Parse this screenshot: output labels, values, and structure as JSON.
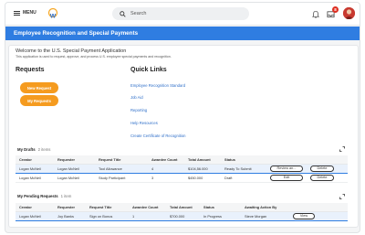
{
  "topbar": {
    "menu_label": "MENU",
    "search_placeholder": "Search",
    "inbox_badge": "8"
  },
  "banner": {
    "title": "Employee Recognition and Special Payments"
  },
  "welcome": {
    "title": "Welcome to the U.S. Special Payment Application",
    "subtitle": "This application is used to request, approve, and process U.S. employee special payments and recognition."
  },
  "requests": {
    "heading": "Requests",
    "new_request": "New Request",
    "my_requests": "My Requests"
  },
  "quick_links": {
    "heading": "Quick Links",
    "items": [
      "Employee Recognition Standard",
      "Job Aid",
      "Reporting",
      "Help Resources",
      "Create Certificate of Recognition"
    ]
  },
  "drafts": {
    "title": "My Drafts",
    "count": "2 items",
    "columns": [
      "Creator",
      "Requester",
      "Request Title",
      "Awardee Count",
      "Total Amount",
      "Status"
    ],
    "rows": [
      {
        "creator": "Logan McNeil",
        "requester": "Logan McNeil",
        "title": "Tool Allowance",
        "awardee_count": "4",
        "total_amount": "$104,56.000",
        "status": "Ready To Submit",
        "action1": "Review an...",
        "action2": "Delete"
      },
      {
        "creator": "Logan McNeil",
        "requester": "Logan McNeil",
        "title": "Study Participant",
        "awardee_count": "3",
        "total_amount": "$450.000",
        "status": "Draft",
        "action1": "Edit",
        "action2": "Delete"
      }
    ]
  },
  "pending": {
    "title": "My Pending Requests",
    "count": "1 item",
    "columns": [
      "Creator",
      "Requester",
      "Request Title",
      "Awardee Count",
      "Total Amount",
      "Status",
      "Awaiting Action By"
    ],
    "rows": [
      {
        "creator": "Logan McNeil",
        "requester": "Joy Banks",
        "title": "Sign on Bonus",
        "awardee_count": "1",
        "total_amount": "$700.000",
        "status": "In Progress",
        "awaiting": "Steve Morgan",
        "action": "View"
      }
    ]
  },
  "colors": {
    "brand_blue": "#2f7de1",
    "orange": "#f59b1f",
    "link": "#2f6fc9",
    "badge_red": "#de2e21"
  }
}
